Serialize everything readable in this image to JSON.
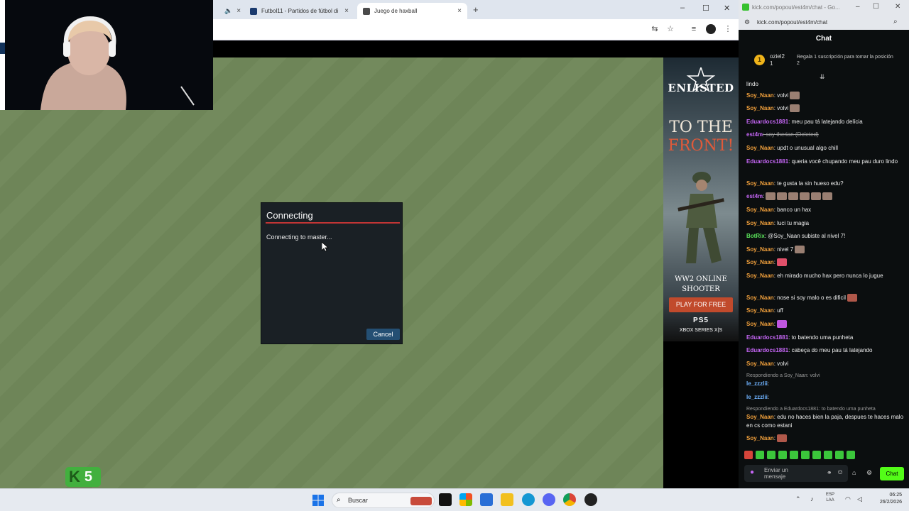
{
  "browser": {
    "tabs": [
      {
        "label": "",
        "favicon_color": "#555555"
      },
      {
        "label": "Futbol11 - Partidos de fútbol di",
        "favicon_color": "#1a3a6e"
      },
      {
        "label": "Juego de haxball",
        "favicon_color": "#4a4a4a"
      }
    ],
    "new_tab": "+",
    "window_controls": [
      "–",
      "☐",
      "✕"
    ]
  },
  "dialog": {
    "title": "Connecting",
    "message": "Connecting to master...",
    "cancel_label": "Cancel"
  },
  "ad": {
    "logo": "ENLISTED",
    "headline_1": "TO THE",
    "headline_2": "FRONT!",
    "sub_1": "WW2 ONLINE",
    "sub_2": "SHOOTER",
    "play_label": "PLAY FOR FREE",
    "platform_1": "PS5",
    "platform_2": "XBOX SERIES X|S"
  },
  "kick_badge": {
    "letter": "K",
    "count": "5",
    "color": "#42b03e"
  },
  "chat_window": {
    "title": "kick.com/popout/est4m/chat - Go...",
    "url": "kick.com/popout/est4m/chat",
    "header": "Chat",
    "pinned": {
      "rank": "1",
      "user": "oziel2",
      "count": "1",
      "description": "Regala 1 suscripción para tomar la posición 2"
    },
    "messages": [
      {
        "user": "",
        "text": "lindo"
      },
      {
        "user": "Soy_Naan",
        "text": ": volvi"
      },
      {
        "user": "Soy_Naan",
        "text": ": volvi"
      },
      {
        "user": "Eduardocs1881",
        "text": ": meu pau tá latejando delícia"
      },
      {
        "user": "est4m",
        "text": ": soy therian (Deleted)"
      },
      {
        "user": "Soy_Naan",
        "text": ": updt o unusual algo chill"
      },
      {
        "user": "Eduardocs1881",
        "text": ": queria você chupando meu pau duro lindo"
      },
      {
        "user": "Soy_Naan",
        "text": ": te gusta la sin hueso edu?"
      },
      {
        "user": "est4m",
        "text": ":"
      },
      {
        "user": "Soy_Naan",
        "text": ": banco un hax"
      },
      {
        "user": "Soy_Naan",
        "text": ": luci tu magia"
      },
      {
        "user": "BotRix",
        "text": ": @Soy_Naan subiste al nivel 7!"
      },
      {
        "user": "Soy_Naan",
        "text": ": nivel 7"
      },
      {
        "user": "Soy_Naan",
        "text": ":"
      },
      {
        "user": "Soy_Naan",
        "text": ": eh mirado mucho hax pero nunca lo jugue"
      },
      {
        "user": "Soy_Naan",
        "text": ": nose si soy malo o es dificil"
      },
      {
        "user": "Soy_Naan",
        "text": ": uff"
      },
      {
        "user": "Soy_Naan",
        "text": ":"
      },
      {
        "user": "Eduardocs1881",
        "text": ": to batendo uma punheta"
      },
      {
        "user": "Eduardocs1881",
        "text": ": cabeça do meu pau tá latejando"
      },
      {
        "user": "Soy_Naan",
        "text": ": volvi"
      },
      {
        "user": "",
        "text": "Respondiendo a Soy_Naan: volvi"
      },
      {
        "user": "le_zzzlii",
        "text": ":"
      },
      {
        "user": "le_zzzlii",
        "text": ":"
      },
      {
        "user": "",
        "text": "Respondiendo a Eduardocs1881: to batendo uma punheta"
      },
      {
        "user": "Soy_Naan",
        "text": ": edu no haces bien la paja, despues te haces malo en cs como estani"
      },
      {
        "user": "Soy_Naan",
        "text": ":"
      }
    ],
    "input_placeholder": "Enviar un mensaje",
    "chat_button": "Chat"
  },
  "taskbar": {
    "search_placeholder": "Buscar",
    "lang_1": "ESP",
    "lang_2": "LAA",
    "time": "06:25",
    "date": "26/2/2026"
  }
}
